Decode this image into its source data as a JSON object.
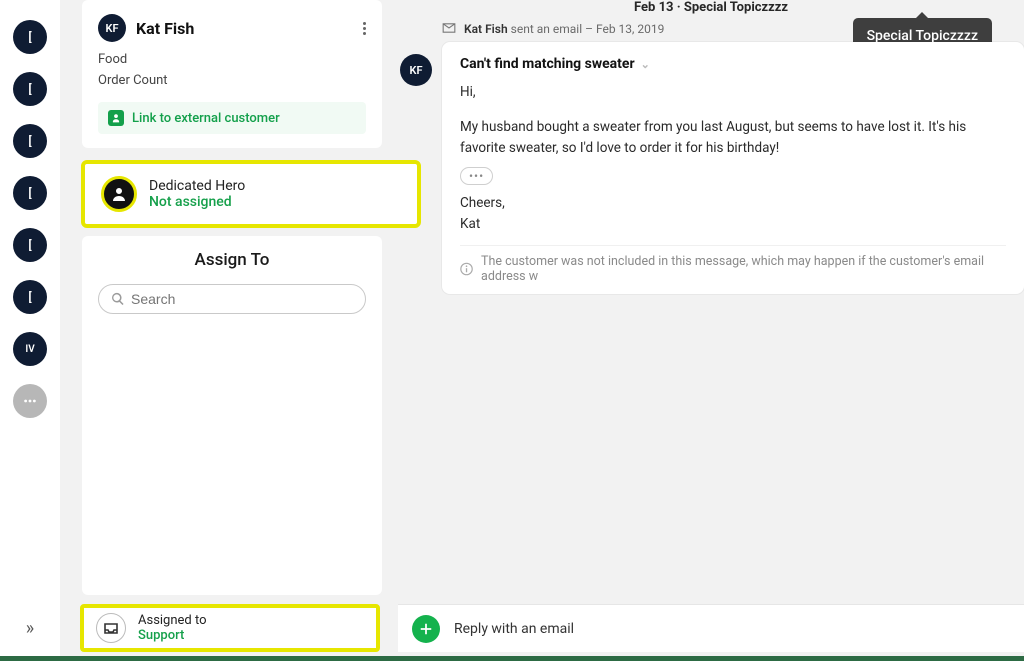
{
  "nav": {
    "items": [
      {
        "label": "[",
        "online": true
      },
      {
        "label": "[",
        "online": true
      },
      {
        "label": "[",
        "online": false
      },
      {
        "label": "[",
        "online": true
      },
      {
        "label": "[",
        "online": true
      },
      {
        "label": "[",
        "online": true
      },
      {
        "label": "IV",
        "online": false
      }
    ]
  },
  "customer": {
    "initials": "KF",
    "name": "Kat Fish",
    "fields": [
      "Food",
      "Order Count"
    ],
    "external_link_label": "Link to external customer"
  },
  "hero": {
    "title": "Dedicated Hero",
    "status": "Not assigned"
  },
  "assign": {
    "heading": "Assign To",
    "search_placeholder": "Search"
  },
  "assigned": {
    "label": "Assigned to",
    "value": "Support"
  },
  "reply_placeholder": "Reply with an email",
  "topic": {
    "line": "Feb 13 · Special Topiczzzz",
    "tooltip": "Special Topiczzzz"
  },
  "message": {
    "avatar": "KF",
    "actor": "Kat Fish",
    "action_suffix": "sent an email –",
    "date": "Feb 13, 2019",
    "subject": "Can't find matching sweater",
    "body": {
      "greeting": "Hi,",
      "p1": "My husband bought a sweater from you last August, but seems to have lost it. It's his favorite sweater, so I'd love to order it for his birthday!",
      "signoff1": "Cheers,",
      "signoff2": "Kat"
    },
    "ellipsis": "•••",
    "footer_note": "The customer was not included in this message, which may happen if the customer's email address w"
  }
}
